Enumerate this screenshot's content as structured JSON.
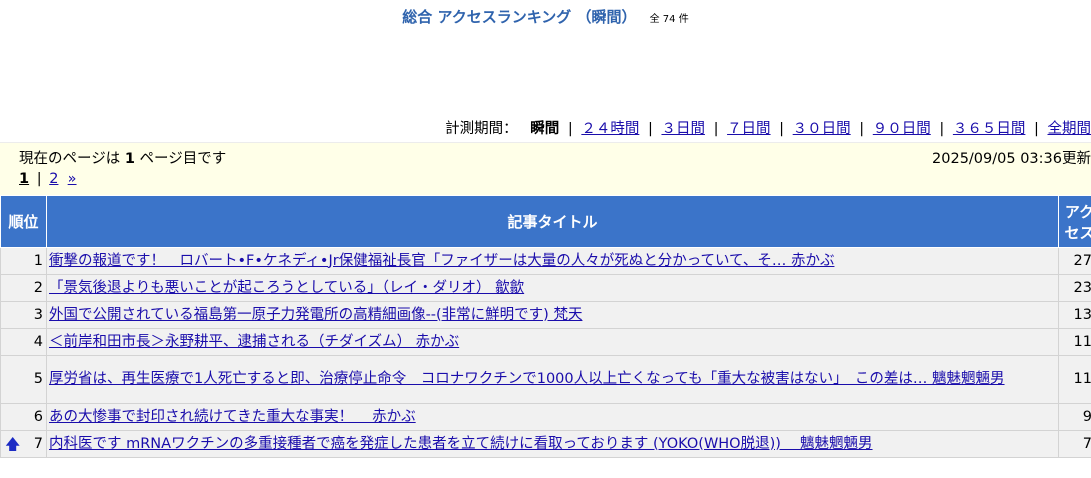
{
  "header": {
    "title": "総合 アクセスランキング （瞬間）",
    "total": "全 74 件"
  },
  "period": {
    "label": "計測期間：",
    "current": "瞬間",
    "links": [
      "２４時間",
      "３日間",
      "７日間",
      "３０日間",
      "９０日間",
      "３６５日間",
      "全期間"
    ]
  },
  "status": {
    "page_prefix": "現在のページは",
    "page_number": "1",
    "page_suffix": "ページ目です",
    "updated": "2025/09/05 03:36更新"
  },
  "pager": {
    "current": "1",
    "next_page": "2",
    "next_arrow": "»"
  },
  "table": {
    "headers": {
      "rank": "順位",
      "title": "記事タイトル",
      "access": "アクセス"
    },
    "rows": [
      {
        "rank": "1",
        "title": "衝撃の報道です！　ロバート•F•ケネディ•Jr保健福祉長官「ファイザーは大量の人々が死ぬと分かっていて、そ… 赤かぶ",
        "access": "27",
        "trend": ""
      },
      {
        "rank": "2",
        "title": "「景気後退よりも悪いことが起ころうとしている」（レイ・ダリオ） 歙歙",
        "access": "23",
        "trend": ""
      },
      {
        "rank": "3",
        "title": "外国で公開されている福島第一原子力発電所の高精細画像--(非常に鮮明です) 梵天",
        "access": "13",
        "trend": ""
      },
      {
        "rank": "4",
        "title": "＜前岸和田市長＞永野耕平、逮捕される（チダイズム） 赤かぶ",
        "access": "11",
        "trend": ""
      },
      {
        "rank": "5",
        "title": "厚労省は、再生医療で1人死亡すると即、治療停止命令　コロナワクチンで1000人以上亡くなっても「重大な被害はない」　この差は… 魑魅魍魎男",
        "access": "11",
        "trend": ""
      },
      {
        "rank": "6",
        "title": "あの大惨事で封印され続けてきた重大な事実！　 赤かぶ",
        "access": "9",
        "trend": ""
      },
      {
        "rank": "7",
        "title": "内科医です mRNAワクチンの多重接種者で癌を発症した患者を立て続けに看取っております (YOKO(WHO脱退))　 魑魅魍魎男",
        "access": "7",
        "trend": "up"
      }
    ]
  },
  "icons": {
    "up": "up-arrow-icon"
  },
  "colors": {
    "accent": "#2f63ad",
    "header_bg": "#3b74c9",
    "link": "#1a0dab",
    "info_bg": "#ffffe8",
    "row_bg": "#f1f1f1"
  }
}
